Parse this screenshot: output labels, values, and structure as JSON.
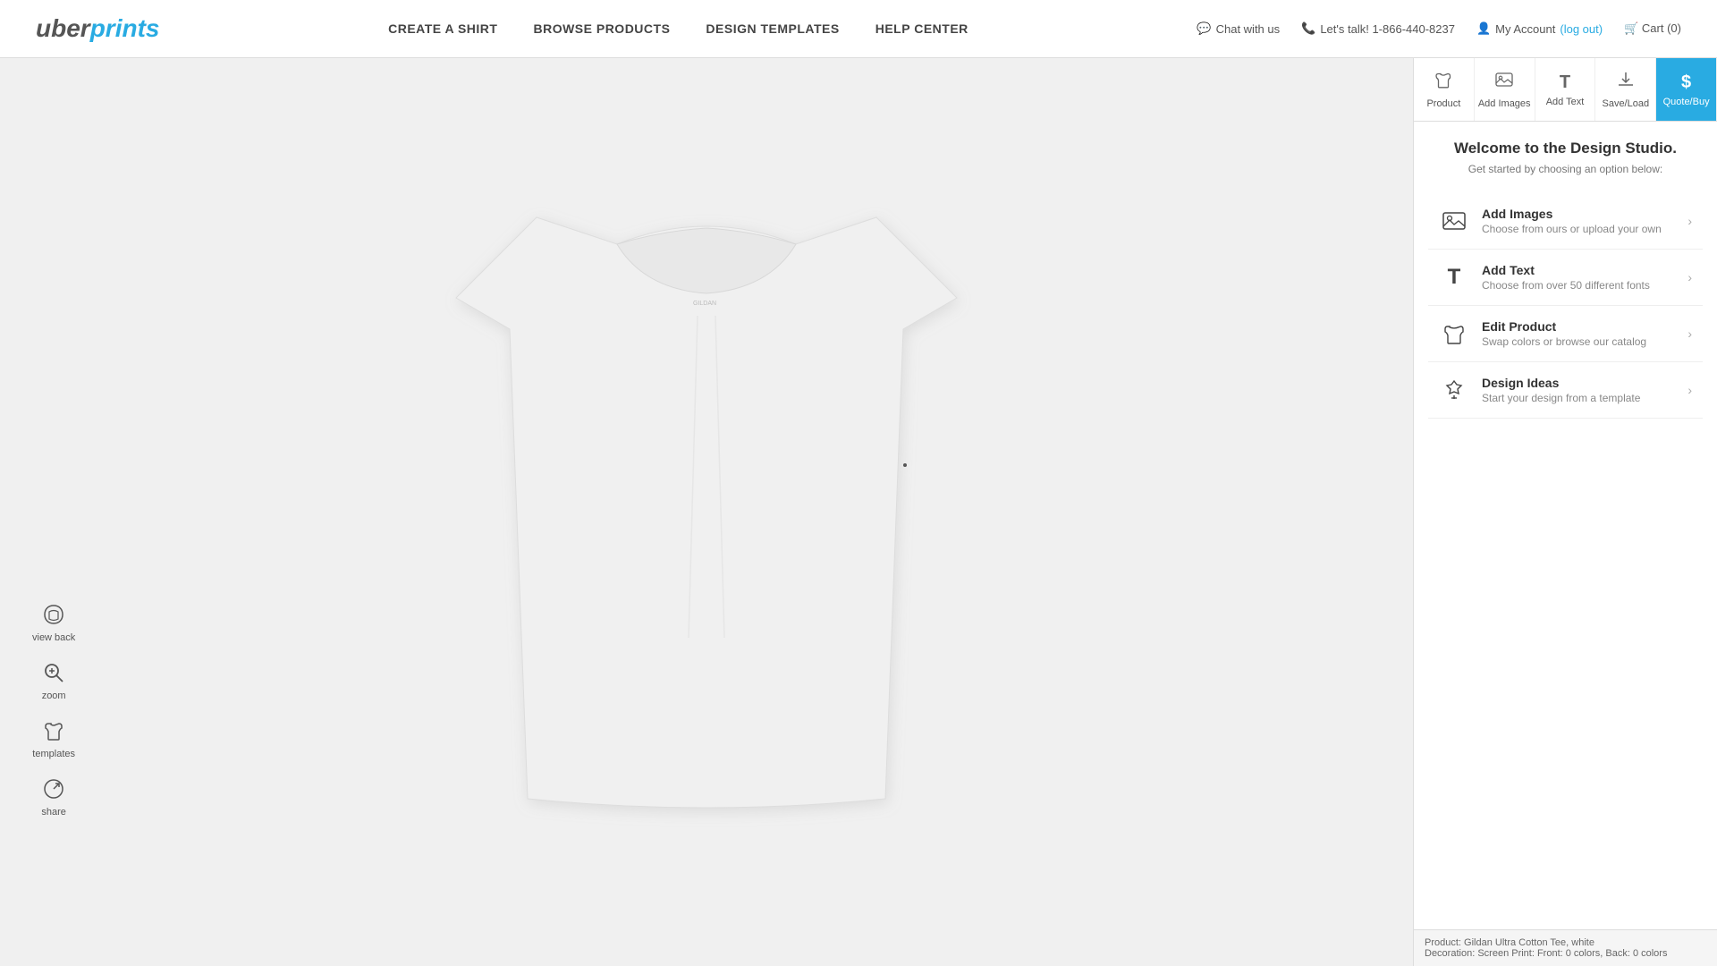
{
  "header": {
    "logo_uber": "uber",
    "logo_prints": "prints",
    "nav": [
      {
        "id": "create",
        "label": "CREATE A SHIRT"
      },
      {
        "id": "browse",
        "label": "BROWSE PRODUCTS"
      },
      {
        "id": "design",
        "label": "DESIGN TEMPLATES"
      },
      {
        "id": "help",
        "label": "HELP CENTER"
      }
    ],
    "chat_label": "Chat with us",
    "phone_label": "Let's talk! 1-866-440-8237",
    "account_label": "My Account",
    "logout_label": "log out",
    "cart_label": "Cart",
    "cart_count": "(0)"
  },
  "toolbar": {
    "tabs": [
      {
        "id": "product",
        "icon": "👕",
        "label": "Product",
        "active": false
      },
      {
        "id": "add-images",
        "icon": "📷",
        "label": "Add Images",
        "active": false
      },
      {
        "id": "add-text",
        "icon": "T",
        "label": "Add Text",
        "active": false
      },
      {
        "id": "save-load",
        "icon": "⬇",
        "label": "Save/Load",
        "active": false
      },
      {
        "id": "quote-buy",
        "icon": "$",
        "label": "Quote/Buy",
        "active": true
      }
    ]
  },
  "studio": {
    "title": "Welcome to the Design Studio.",
    "subtitle": "Get started by choosing an option below:",
    "menu_items": [
      {
        "id": "add-images",
        "icon": "📷",
        "title": "Add Images",
        "description": "Choose from ours or upload your own"
      },
      {
        "id": "add-text",
        "icon": "T",
        "title": "Add Text",
        "description": "Choose from over 50 different fonts"
      },
      {
        "id": "edit-product",
        "icon": "👕",
        "title": "Edit Product",
        "description": "Swap colors or browse our catalog"
      },
      {
        "id": "design-ideas",
        "icon": "💡",
        "title": "Design Ideas",
        "description": "Start your design from a template"
      }
    ]
  },
  "left_tools": [
    {
      "id": "view-back",
      "icon": "👕",
      "label": "view back"
    },
    {
      "id": "zoom",
      "icon": "🔍",
      "label": "zoom"
    },
    {
      "id": "templates",
      "icon": "👕",
      "label": "templates"
    },
    {
      "id": "share",
      "icon": "↗",
      "label": "share"
    }
  ],
  "footer": {
    "product_label": "Product:",
    "product_value": "Gildan Ultra Cotton Tee, white",
    "decoration_label": "Decoration:",
    "decoration_value": "Screen Print: Front: 0 colors, Back: 0 colors"
  }
}
